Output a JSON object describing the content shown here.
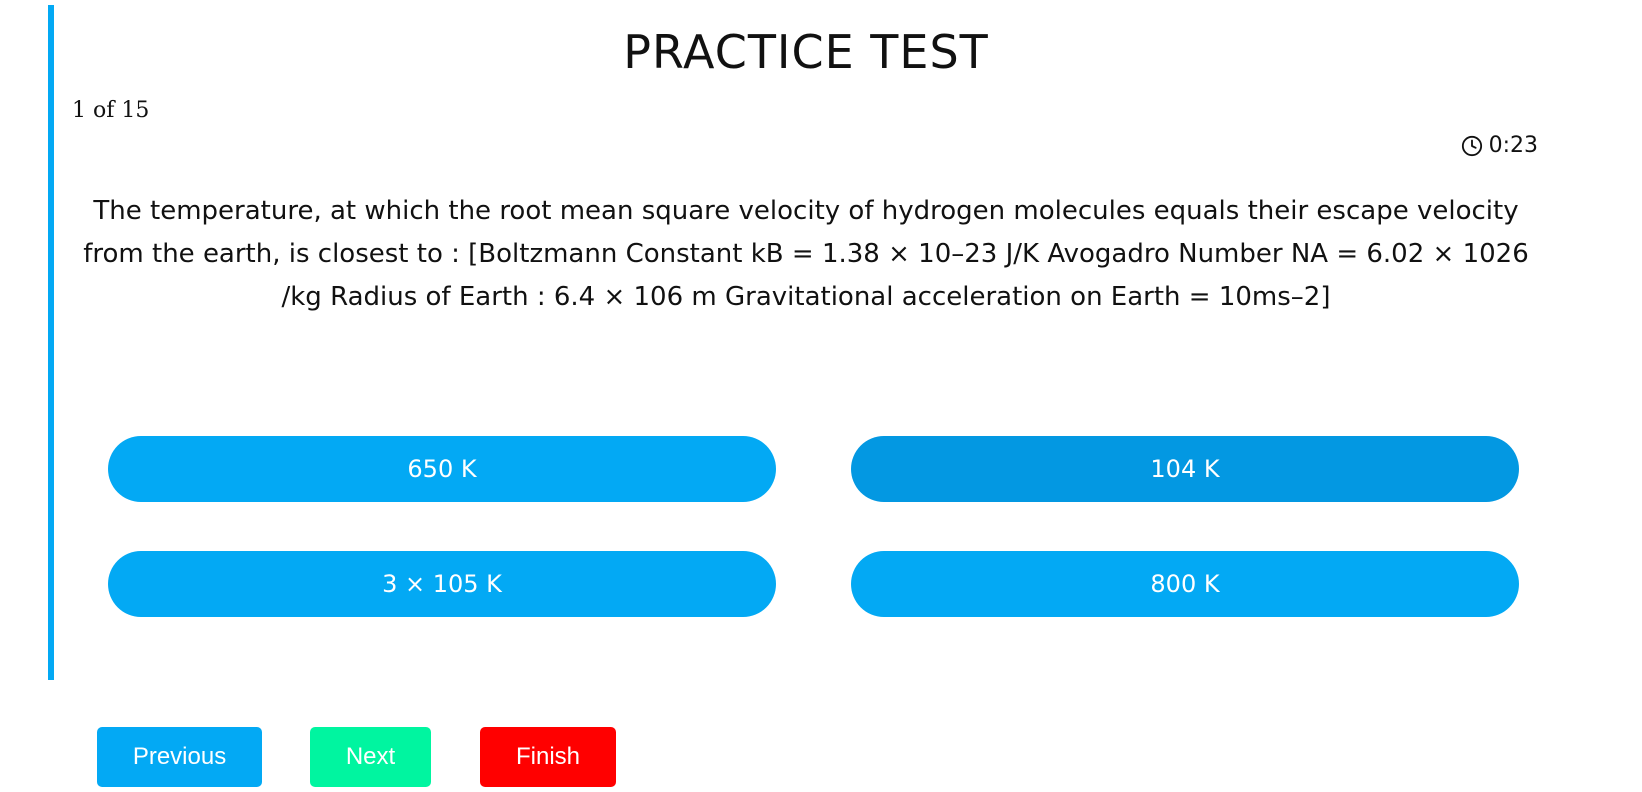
{
  "header": {
    "title": "PRACTICE TEST"
  },
  "progress": {
    "text": "1 of 15"
  },
  "timer": {
    "icon": "clock-icon",
    "text": "0:23"
  },
  "question": {
    "text": "The temperature, at which the root mean square velocity of hydrogen molecules equals their escape velocity from the earth, is closest to : [Boltzmann Constant kB = 1.38 × 10–23 J/K Avogadro Number NA = 6.02 × 1026 /kg Radius of Earth : 6.4 × 106 m Gravitational acceleration on Earth = 10ms–2]"
  },
  "options": [
    {
      "label": "650 K"
    },
    {
      "label": "104 K"
    },
    {
      "label": "3 × 105 K"
    },
    {
      "label": "800 K"
    }
  ],
  "navigation": {
    "previous_label": "Previous",
    "next_label": "Next",
    "finish_label": "Finish"
  },
  "colors": {
    "accent": "#03a9f4",
    "option_hover": "#0398e2",
    "next": "#00f5a0",
    "finish": "#ff0000"
  }
}
